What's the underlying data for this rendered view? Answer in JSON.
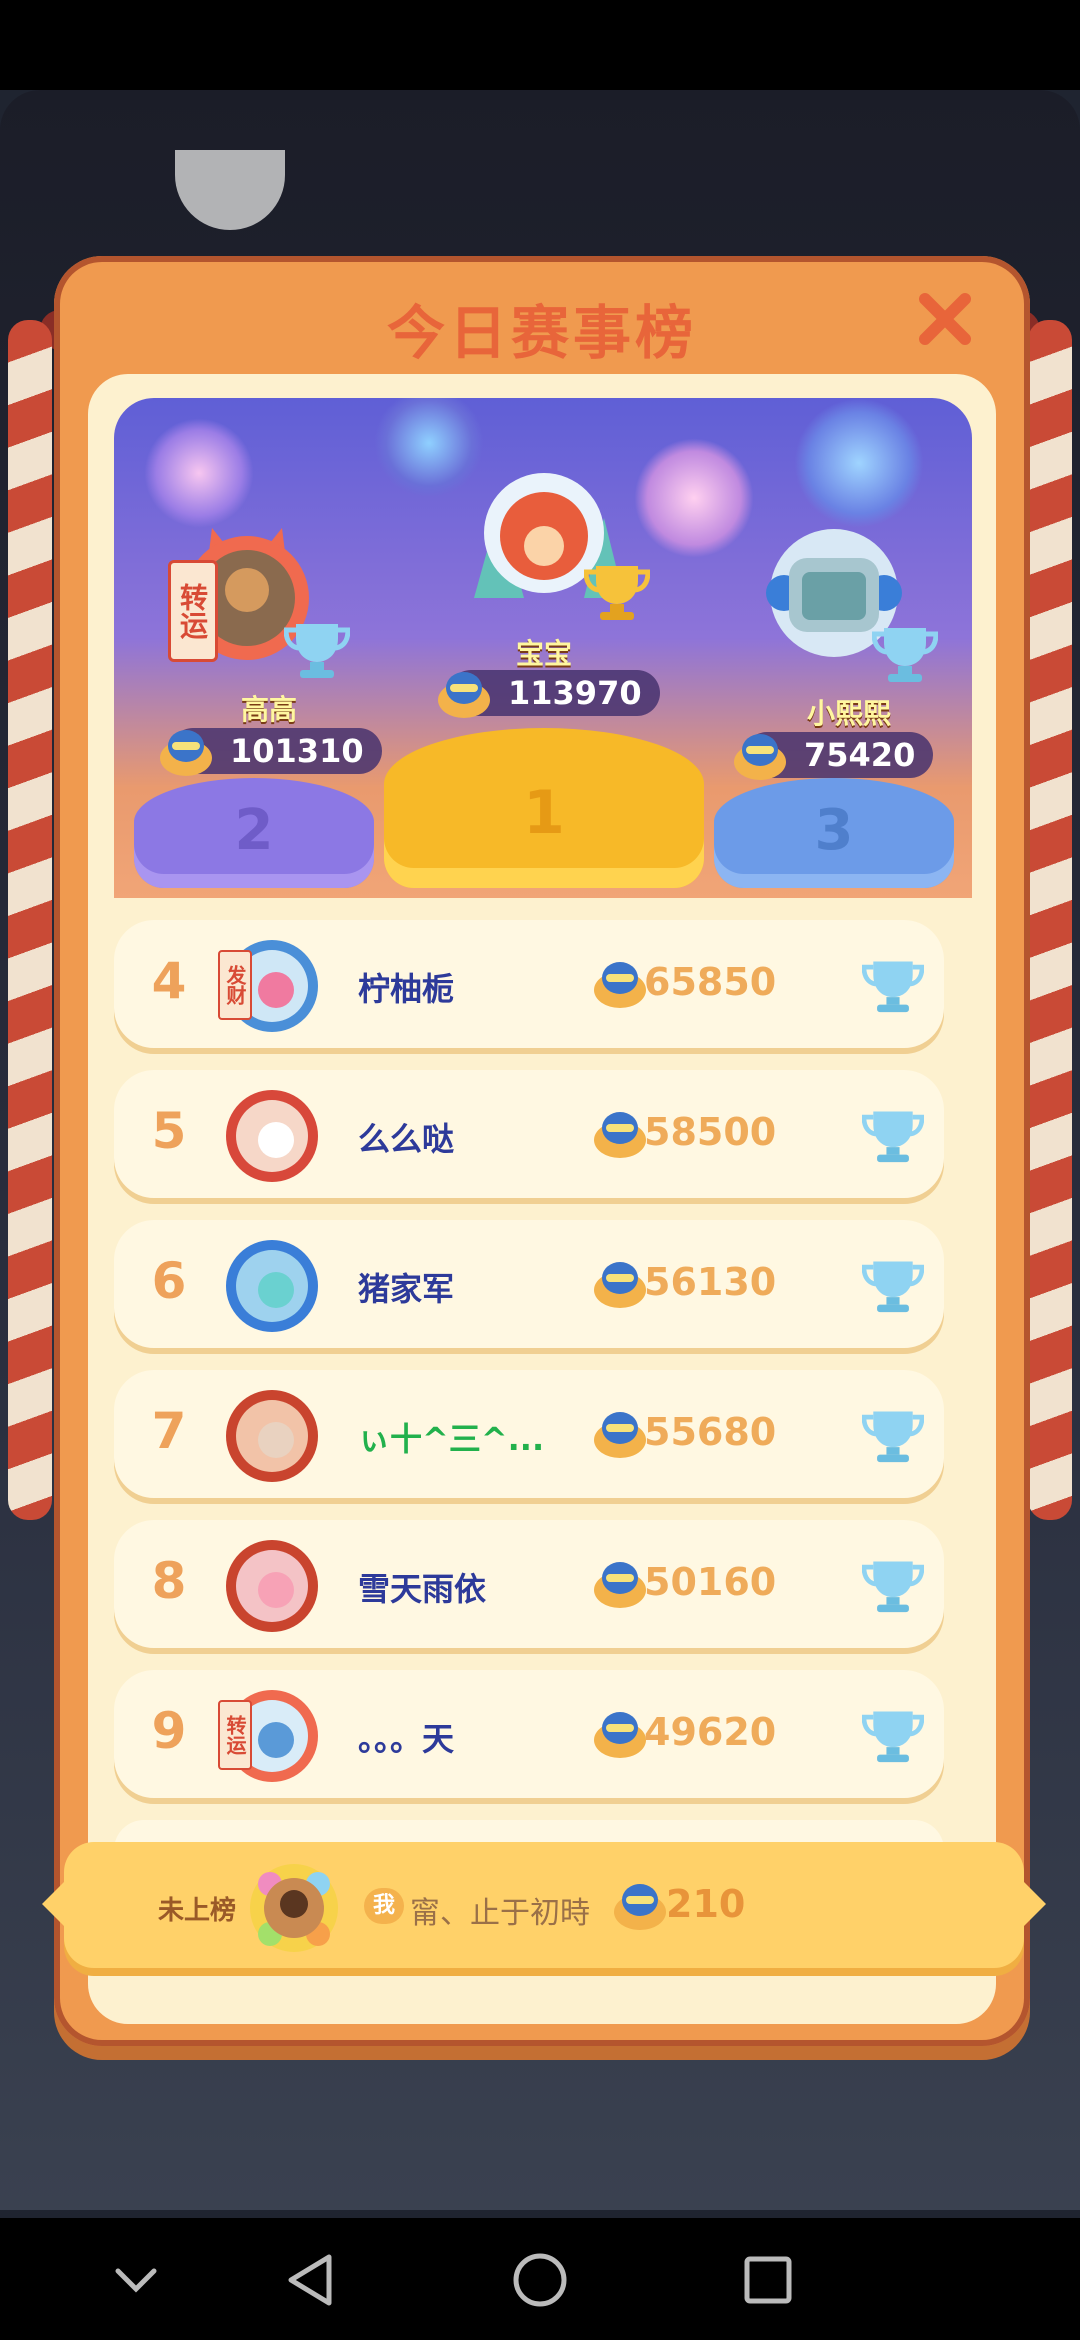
{
  "panel": {
    "title": "今日赛事榜"
  },
  "podium": [
    {
      "place": "2",
      "name": "高高",
      "score": "101310",
      "badge": "转运"
    },
    {
      "place": "1",
      "name": "宝宝",
      "score": "113970"
    },
    {
      "place": "3",
      "name": "小熙熙",
      "score": "75420"
    }
  ],
  "rows": [
    {
      "rank": "4",
      "name": "柠柚栀",
      "score": "65850",
      "avatar_badge": "发财"
    },
    {
      "rank": "5",
      "name": "么么哒",
      "score": "58500"
    },
    {
      "rank": "6",
      "name": "猪家军",
      "score": "56130"
    },
    {
      "rank": "7",
      "name": "ぃ十^三^...",
      "score": "55680"
    },
    {
      "rank": "8",
      "name": "雪天雨依",
      "score": "50160"
    },
    {
      "rank": "9",
      "name": "。。。天",
      "score": "49620",
      "avatar_badge": "转运"
    }
  ],
  "self": {
    "status": "未上榜",
    "me_badge": "我",
    "name": "甯、止于初時",
    "score": "210"
  },
  "colors": {
    "panel": "#f09a4f",
    "title": "#e8653a",
    "score": "#efab5a",
    "name": "#2d3a9a"
  }
}
